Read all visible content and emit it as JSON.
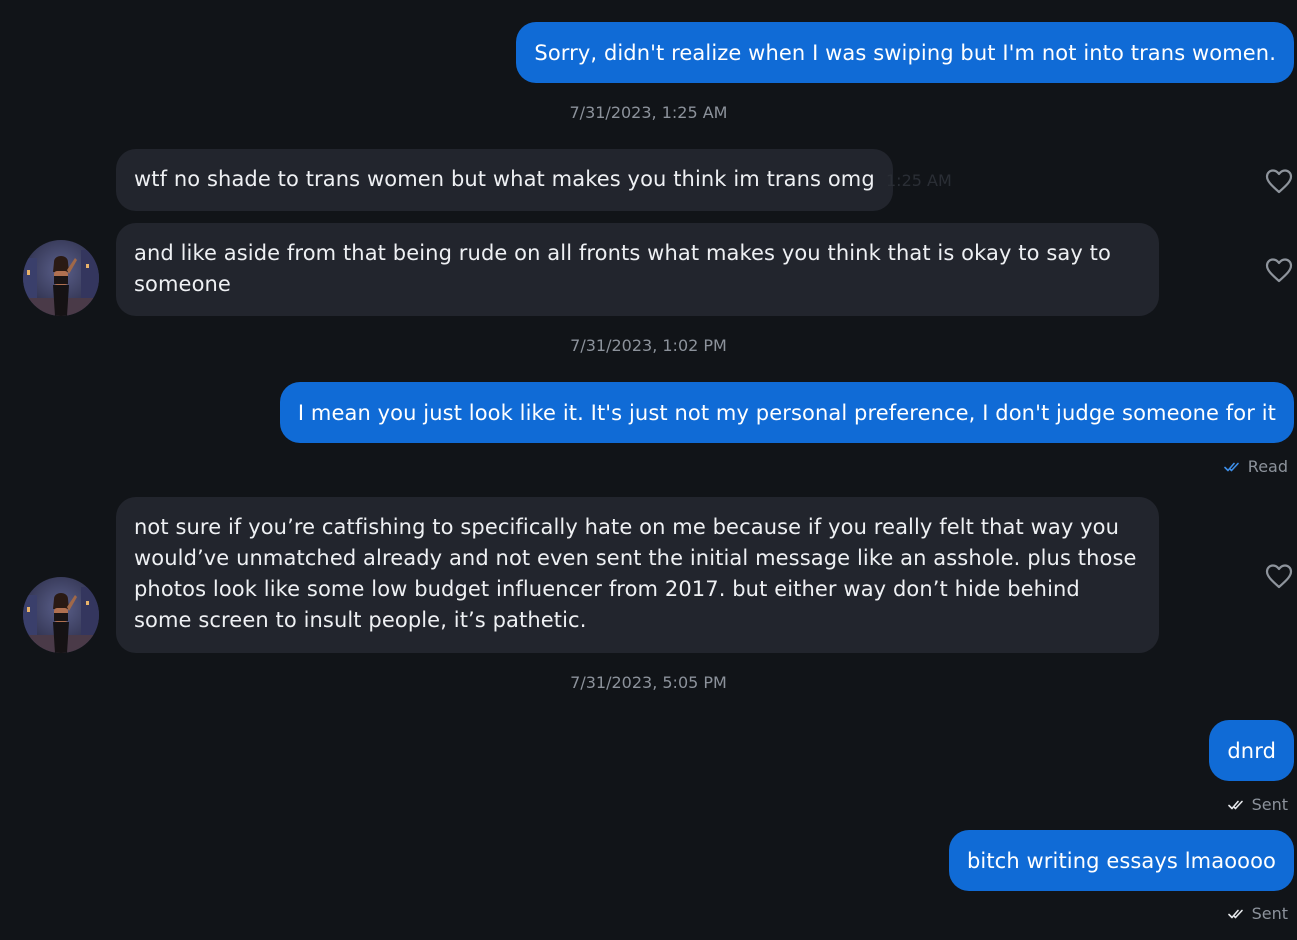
{
  "messages": [
    {
      "text": "Sorry, didn't realize when I was swiping but I'm not into trans women."
    },
    {
      "text": "wtf no shade to trans women but what makes you think im trans omg",
      "time": "1:25 AM"
    },
    {
      "text": "and like aside from that being rude on all fronts what makes you think that is okay to say to someone"
    },
    {
      "text": "I mean you just look like it. It's just not my personal preference, I don't judge someone for it"
    },
    {
      "text": "not sure if you’re catfishing to specifically hate on me because if you really felt that way you would’ve unmatched already and not even sent the initial message like an asshole. plus those photos look like some low budget influencer from 2017. but either way don’t hide behind some screen to insult people, it’s pathetic."
    },
    {
      "text": "dnrd"
    },
    {
      "text": "bitch writing essays lmaoooo"
    }
  ],
  "timestamps": [
    "7/31/2023, 1:25 AM",
    "7/31/2023, 1:02 PM",
    "7/31/2023, 5:05 PM"
  ],
  "statuses": [
    "Read",
    "Sent",
    "Sent"
  ],
  "icons": {
    "like": "heart-outline-icon",
    "read": "double-check-icon",
    "sent": "double-check-icon",
    "avatar": "profile-photo"
  },
  "colors": {
    "background": "#111418",
    "outgoing_bubble": "#106bd6",
    "incoming_bubble": "#22252d",
    "read_check": "#3d8ee8",
    "meta_text": "#8c929b"
  }
}
